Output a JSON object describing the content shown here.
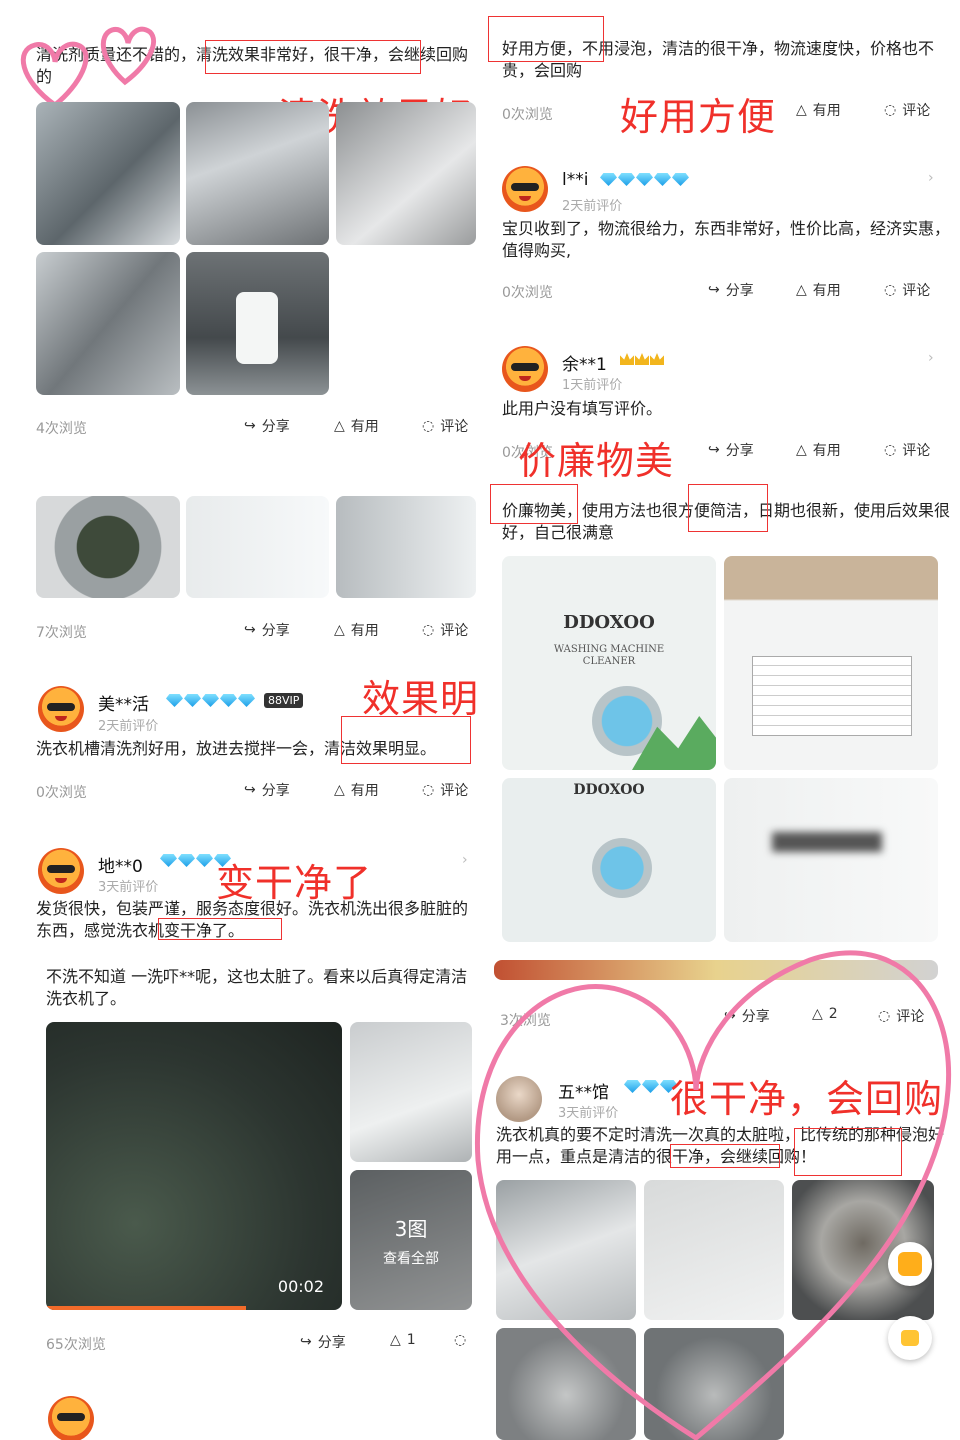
{
  "left": {
    "review1": {
      "text": "清洗剂质量还不错的，清洗效果非常好，很干净，会继续回购的",
      "views": "4次浏览",
      "annotation": "清洗效果好"
    },
    "review2": {
      "views": "7次浏览"
    },
    "review3": {
      "user": "美**活",
      "vip": "88VIP",
      "time": "2天前评价",
      "text": "洗衣机槽清洗剂好用，放进去搅拌一会，清洁效果明显。",
      "views": "0次浏览",
      "annotation": "效果明显"
    },
    "review4": {
      "user": "地**0",
      "time": "3天前评价",
      "text": "发货很快，包装严谨，服务态度很好。洗衣机洗出很多脏脏的东西，感觉洗衣机变干净了。",
      "annotation": "变干净了"
    },
    "review5": {
      "text": "不洗不知道 一洗吓**呢，这也太脏了。看来以后真得定清洁洗衣机了。",
      "video_time": "00:02",
      "more_count": "3图",
      "more_label": "查看全部",
      "views": "65次浏览",
      "useful_count": "1"
    }
  },
  "right": {
    "review1": {
      "text": "好用方便，不用浸泡，清洁的很干净，物流速度快，价格也不贵，会回购",
      "views": "0次浏览",
      "annotation": "好用方便"
    },
    "review2": {
      "user": "l**i",
      "time": "2天前评价",
      "text": "宝贝收到了，物流很给力，东西非常好，性价比高，经济实惠，值得购买,",
      "views": "0次浏览"
    },
    "review3": {
      "user": "余**1",
      "time": "1天前评价",
      "text": "此用户没有填写评价。",
      "views": "0次浏览",
      "annotation": "价廉物美"
    },
    "review4": {
      "text": "价廉物美，使用方法也很方便简洁，日期也很新，使用后效果很好，自己很满意",
      "brand": "DDOXOO",
      "product_line1": "WASHING MACHINE",
      "product_line2": "CLEANER",
      "views": "3次浏览",
      "useful_count": "2"
    },
    "review5": {
      "user": "五**馆",
      "time": "3天前评价",
      "text": "洗衣机真的要不定时清洗一次真的太脏啦，比传统的那种侵泡好用一点，重点是清洁的很干净，会继续回购！",
      "annotation": "很干净，会回购"
    }
  },
  "actions": {
    "share": "分享",
    "useful": "有用",
    "comment": "评论",
    "comment_cut": "评论"
  },
  "colors": {
    "accent_red": "#f0302a",
    "heart_pink": "#f07aa8",
    "diamond": "#1c9fe8"
  }
}
